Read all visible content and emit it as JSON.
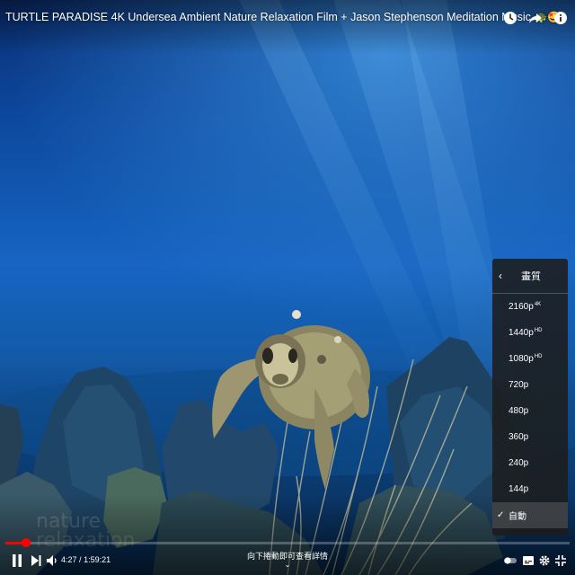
{
  "video": {
    "title": "TURTLE PARADISE 4K Undersea Ambient Nature Relaxation Film + Jason Stephenson Meditation Music",
    "title_emojis": "🐢🤩",
    "watermark_line1": "nature",
    "watermark_line2": "relaxation"
  },
  "top_actions": [
    {
      "icon": "clock-icon",
      "label": "Watch later"
    },
    {
      "icon": "share-icon",
      "label": "Share"
    },
    {
      "icon": "info-icon",
      "label": "Info"
    }
  ],
  "quality_menu": {
    "back_icon": "‹",
    "title": "畫質",
    "options": [
      {
        "label": "2160p",
        "badge": "4K",
        "selected": false
      },
      {
        "label": "1440p",
        "badge": "HD",
        "selected": false
      },
      {
        "label": "1080p",
        "badge": "HD",
        "selected": false
      },
      {
        "label": "720p",
        "badge": "",
        "selected": false
      },
      {
        "label": "480p",
        "badge": "",
        "selected": false
      },
      {
        "label": "360p",
        "badge": "",
        "selected": false
      },
      {
        "label": "240p",
        "badge": "",
        "selected": false
      },
      {
        "label": "144p",
        "badge": "",
        "selected": false
      },
      {
        "label": "自動",
        "badge": "",
        "selected": true
      }
    ],
    "check_mark": "✓"
  },
  "player": {
    "current_time": "4:27",
    "duration": "1:59:21",
    "progress_fraction": 0.037,
    "scroll_hint": "向下捲動即可查看詳情",
    "scroll_hint_chevron": "⌄",
    "accent_color": "#ff0000"
  }
}
